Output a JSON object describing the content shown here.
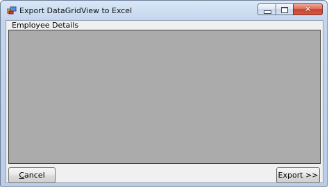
{
  "window": {
    "title": "Export DataGridView to Excel"
  },
  "group": {
    "label": "Employee Details"
  },
  "buttons": {
    "cancel": {
      "accel": "C",
      "rest": "ancel"
    },
    "export": {
      "label": "Export >>"
    }
  },
  "icons": {
    "app": "app-window-icon",
    "minimize": "minimize-icon",
    "maximize": "maximize-icon",
    "close": "close-icon"
  },
  "colors": {
    "grid_background": "#ababab",
    "client_background": "#f0f0f0",
    "close_button": "#c8402c"
  }
}
